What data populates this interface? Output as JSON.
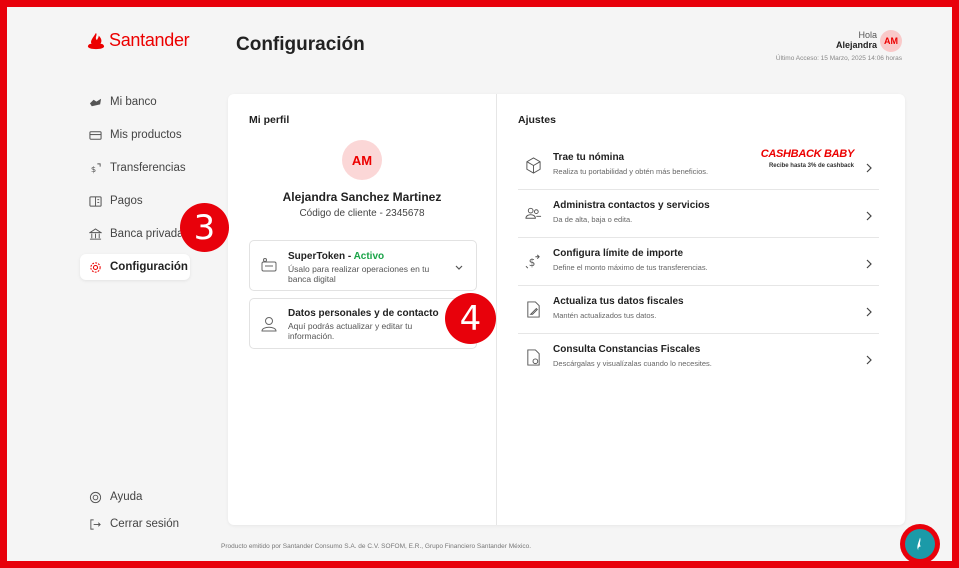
{
  "brand": {
    "name": "Santander",
    "color": "#ec0000"
  },
  "header": {
    "title": "Configuración",
    "greeting": "Hola",
    "user_first_name": "Alejandra",
    "avatar_initials": "AM",
    "last_access": "Último Acceso: 15 Marzo, 2025 14:06 horas"
  },
  "sidebar": {
    "items": [
      {
        "label": "Mi banco",
        "icon": "bank-icon"
      },
      {
        "label": "Mis productos",
        "icon": "card-icon"
      },
      {
        "label": "Transferencias",
        "icon": "transfer-icon"
      },
      {
        "label": "Pagos",
        "icon": "payments-icon"
      },
      {
        "label": "Banca privada",
        "icon": "private-bank-icon"
      },
      {
        "label": "Configuración",
        "icon": "gear-icon",
        "active": true
      }
    ],
    "bottom": [
      {
        "label": "Ayuda",
        "icon": "help-icon"
      },
      {
        "label": "Cerrar sesión",
        "icon": "logout-icon"
      }
    ]
  },
  "badges": {
    "step3": "3",
    "step4": "4"
  },
  "profile": {
    "section_title": "Mi perfil",
    "initials": "AM",
    "full_name": "Alejandra Sanchez Martinez",
    "client_code": "Código de cliente - 2345678",
    "supertoken": {
      "title": "SuperToken - ",
      "status": "Activo",
      "description": "Úsalo para realizar operaciones en tu banca digital"
    },
    "personal_data": {
      "title": "Datos personales y de contacto",
      "description": "Aquí podrás actualizar y editar tu información."
    }
  },
  "settings": {
    "section_title": "Ajustes",
    "rows": [
      {
        "title": "Trae tu nómina",
        "description": "Realiza tu portabilidad y obtén más beneficios.",
        "icon": "payroll-icon"
      },
      {
        "title": "Administra contactos y servicios",
        "description": "Da de alta, baja o edita.",
        "icon": "contacts-icon"
      },
      {
        "title": "Configura límite de importe",
        "description": "Define el monto máximo de tus transferencias.",
        "icon": "limit-icon"
      },
      {
        "title": "Actualiza tus datos fiscales",
        "description": "Mantén actualizados tus datos.",
        "icon": "fiscal-edit-icon"
      },
      {
        "title": "Consulta Constancias Fiscales",
        "description": "Descárgalas y visualízalas cuando lo necesites.",
        "icon": "fiscal-doc-icon"
      }
    ],
    "cashback": {
      "title": "CASHBACK BABY",
      "subtitle": "Recibe hasta 3% de cashback"
    }
  },
  "footer": "Producto emitido por Santander Consumo S.A. de C.V. SOFOM, E.R., Grupo Financiero Santander México."
}
